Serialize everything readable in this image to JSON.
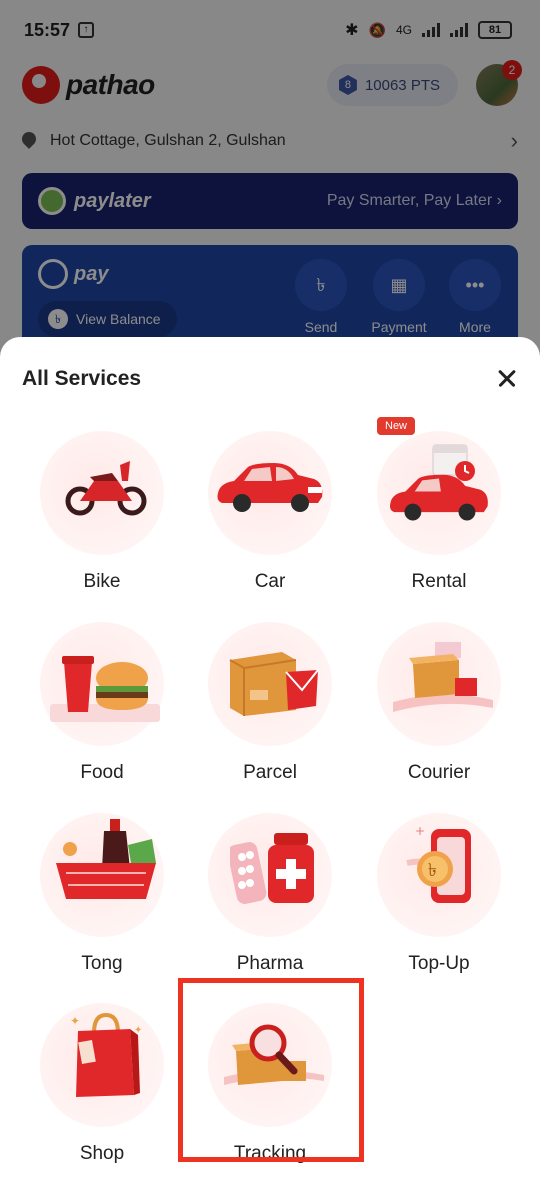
{
  "status_bar": {
    "time": "15:57",
    "network": "4G",
    "battery": "81"
  },
  "header": {
    "brand": "pathao",
    "points": "10063 PTS",
    "notification_count": "2"
  },
  "location": {
    "address": "Hot Cottage, Gulshan 2, Gulshan"
  },
  "paylater": {
    "brand": "paylater",
    "tagline": "Pay Smarter, Pay Later"
  },
  "pay": {
    "brand": "pay",
    "view_balance": "View Balance",
    "actions": [
      {
        "label": "Send"
      },
      {
        "label": "Payment"
      },
      {
        "label": "More"
      }
    ]
  },
  "sheet": {
    "title": "All Services",
    "services": [
      {
        "label": "Bike"
      },
      {
        "label": "Car"
      },
      {
        "label": "Rental",
        "badge": "New"
      },
      {
        "label": "Food"
      },
      {
        "label": "Parcel"
      },
      {
        "label": "Courier"
      },
      {
        "label": "Tong"
      },
      {
        "label": "Pharma"
      },
      {
        "label": "Top-Up"
      },
      {
        "label": "Shop"
      },
      {
        "label": "Tracking"
      }
    ]
  },
  "colors": {
    "brand_red": "#e31d1a",
    "paylater_bg": "#18246e",
    "pay_bg": "#1f47a8",
    "highlight": "#ee3322"
  }
}
